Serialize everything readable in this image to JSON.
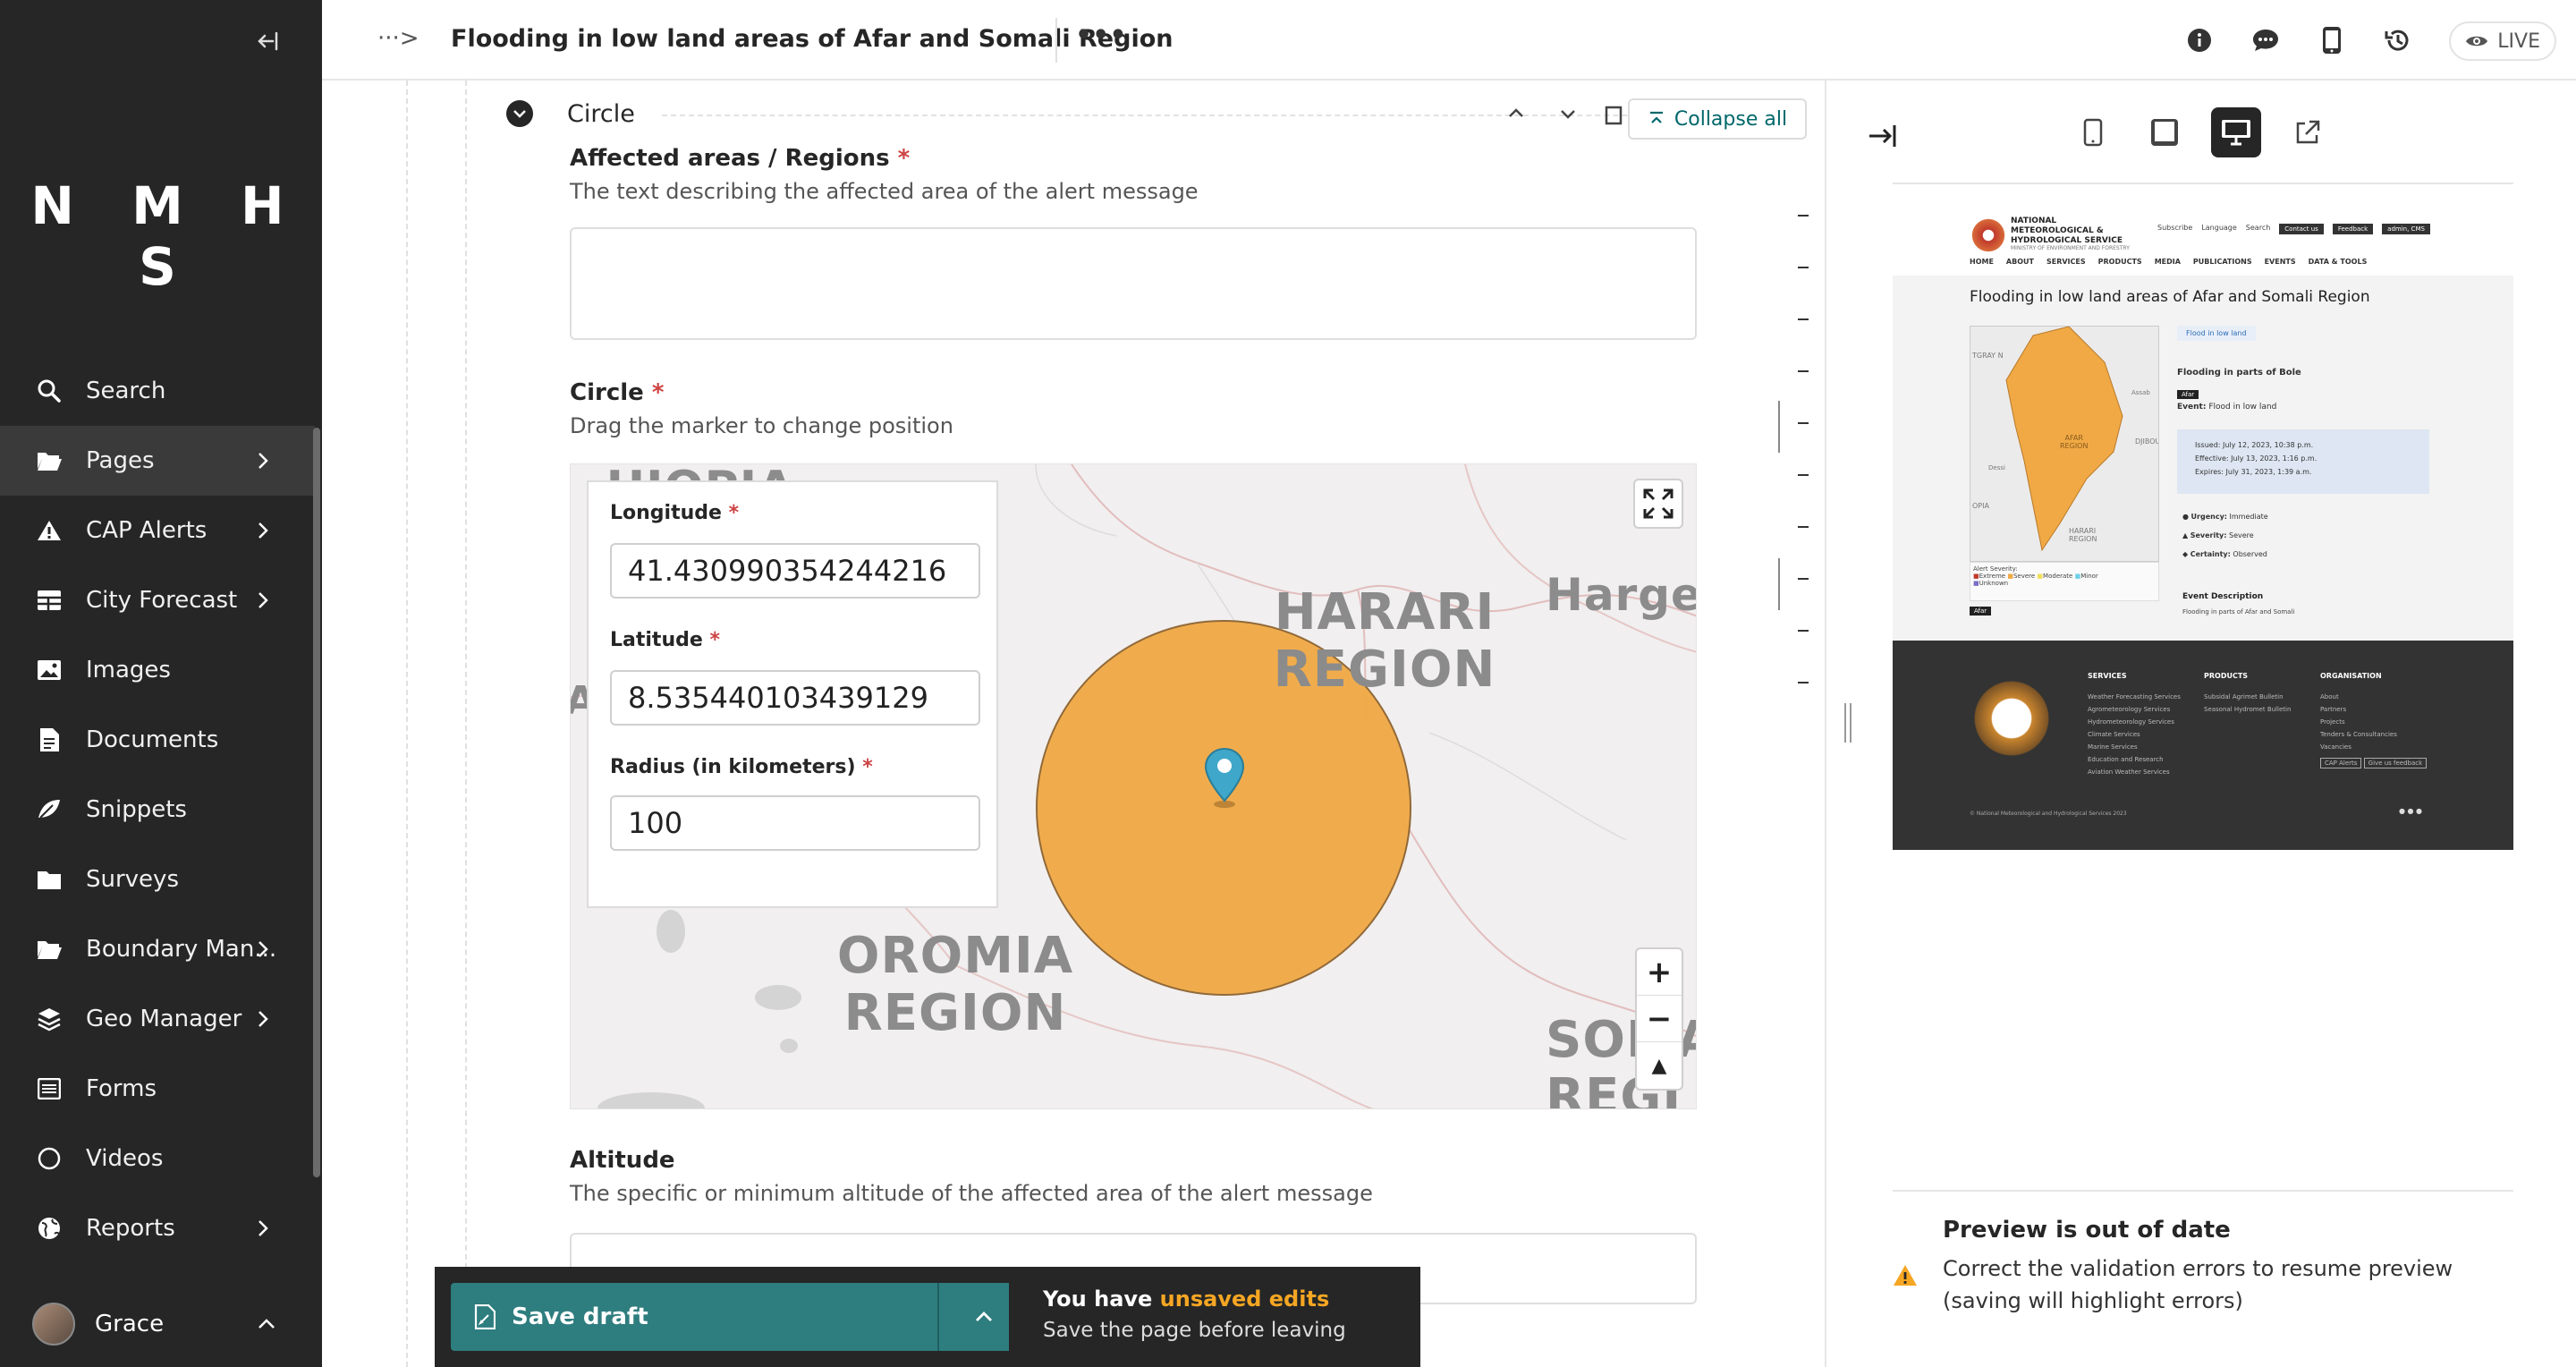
{
  "sidebar": {
    "logo": "N M H S",
    "items": [
      {
        "label": "Search",
        "icon": "search-icon",
        "submenu": false
      },
      {
        "label": "Pages",
        "icon": "folder-open-icon",
        "submenu": true
      },
      {
        "label": "CAP Alerts",
        "icon": "warning-icon",
        "submenu": true
      },
      {
        "label": "City Forecast",
        "icon": "table-icon",
        "submenu": true
      },
      {
        "label": "Images",
        "icon": "image-icon",
        "submenu": false
      },
      {
        "label": "Documents",
        "icon": "document-icon",
        "submenu": false
      },
      {
        "label": "Snippets",
        "icon": "snippet-icon",
        "submenu": false
      },
      {
        "label": "Surveys",
        "icon": "folder-icon",
        "submenu": false
      },
      {
        "label": "Boundary Man...",
        "icon": "folder-open-icon",
        "submenu": true
      },
      {
        "label": "Geo Manager",
        "icon": "layers-icon",
        "submenu": true
      },
      {
        "label": "Forms",
        "icon": "list-icon",
        "submenu": false
      },
      {
        "label": "Videos",
        "icon": "circle-icon",
        "submenu": false
      },
      {
        "label": "Reports",
        "icon": "globe-icon",
        "submenu": true
      }
    ],
    "user": "Grace"
  },
  "header": {
    "breadcrumb": "···>",
    "title": "Flooding in low land areas of Afar and Somali Region",
    "more": "•••",
    "live_label": "LIVE"
  },
  "editor": {
    "section_title": "Circle",
    "collapse_all": "Collapse all",
    "affected_label": "Affected areas / Regions",
    "affected_help": "The text describing the affected area of the alert message",
    "circle_label": "Circle",
    "circle_help": "Drag the marker to change position",
    "required": "*",
    "map": {
      "longitude_label": "Longitude",
      "longitude_value": "41.430990354244216",
      "latitude_label": "Latitude",
      "latitude_value": "8.535440103439129",
      "radius_label": "Radius (in kilometers)",
      "radius_value": "100",
      "place_labels": {
        "harari": "HARARI\nREGION",
        "oromia": "OROMIA\nREGION",
        "hargeisa": "Hargei",
        "ethiopia": "HIOPIA",
        "somali": "SOMA\nREGI",
        "afar_edge": "A"
      },
      "zoom_in": "+",
      "zoom_out": "−",
      "north": "▲"
    },
    "altitude_label": "Altitude",
    "altitude_help": "The specific or minimum altitude of the affected area of the alert message"
  },
  "savebar": {
    "save_label": "Save draft",
    "msg_prefix": "You have ",
    "msg_highlight": "unsaved edits",
    "msg_sub": "Save the page before leaving"
  },
  "preview": {
    "site": {
      "org": "NATIONAL METEOROLOGICAL & HYDROLOGICAL SERVICE",
      "org_sub": "MINISTRY OF ENVIRONMENT AND FORESTRY",
      "top_links": [
        "Subscribe",
        "Language",
        "Search"
      ],
      "top_buttons": [
        "Contact us",
        "Feedback",
        "admin, CMS"
      ],
      "nav": [
        "HOME",
        "ABOUT",
        "SERVICES",
        "PRODUCTS",
        "MEDIA",
        "PUBLICATIONS",
        "EVENTS",
        "DATA & TOOLS"
      ],
      "title": "Flooding in low land areas of Afar and Somali Region",
      "chip": "Flood in low land",
      "alert_title": "Flooding in parts of Bole",
      "area_tag": "Afar",
      "event_label": "Event:",
      "event_value": "Flood in low land",
      "issued": "Issued: July 12, 2023, 10:38 p.m.",
      "effective": "Effective: July 13, 2023, 1:16 p.m.",
      "expires": "Expires: July 31, 2023, 1:39 a.m.",
      "urgency_label": "Urgency:",
      "urgency_value": "Immediate",
      "severity_label": "Severity:",
      "severity_value": "Severe",
      "certainty_label": "Certainty:",
      "certainty_value": "Observed",
      "event_desc_title": "Event Description",
      "event_desc": "Flooding in parts of Afar and Somali",
      "legend_title": "Alert Severity:",
      "legend": [
        "Extreme",
        "Severe",
        "Moderate",
        "Minor",
        "Unknown"
      ],
      "mini_map_labels": [
        "TGRAY N",
        "AFAR\nREGION",
        "DJIBOUT",
        "OPIA",
        "HARARI\nREGION",
        "Assab",
        "Dessi"
      ],
      "footer_cols": [
        {
          "title": "SERVICES",
          "items": [
            "Weather Forecasting Services",
            "Agrometeorology Services",
            "Hydrometeorology Services",
            "Climate Services",
            "Marine Services",
            "Education and Research",
            "Aviation Weather Services"
          ]
        },
        {
          "title": "PRODUCTS",
          "items": [
            "Subsidal Agrimet Bulletin",
            "Seasonal Hydromet Bulletin"
          ]
        },
        {
          "title": "ORGANISATION",
          "items": [
            "About",
            "Partners",
            "Projects",
            "Tenders & Consultancies",
            "Vacancies"
          ]
        }
      ],
      "footer_buttons": [
        "CAP Alerts",
        "Give us feedback"
      ],
      "copyright": "© National Meteorological and Hydrological Services 2023"
    },
    "warn_title": "Preview is out of date",
    "warn_text": "Correct the validation errors to resume preview (saving will highlight errors)"
  },
  "colors": {
    "sidebar_bg": "#262626",
    "accent_teal": "#2e7d7f",
    "circle_fill": "#f0a944",
    "marker_blue": "#3fa7c9",
    "required_red": "#cd4444",
    "warning_orange": "#f5a623"
  }
}
